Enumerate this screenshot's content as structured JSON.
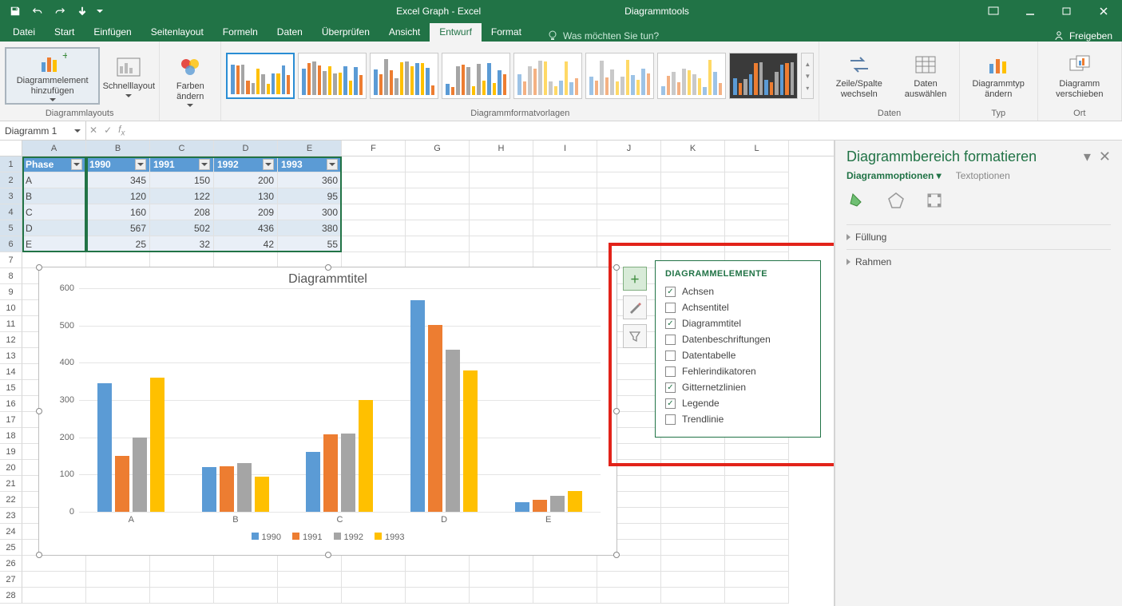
{
  "titlebar": {
    "app_title": "Excel Graph - Excel",
    "context_tab": "Diagrammtools"
  },
  "tabs": {
    "items": [
      "Datei",
      "Start",
      "Einfügen",
      "Seitenlayout",
      "Formeln",
      "Daten",
      "Überprüfen",
      "Ansicht",
      "Entwurf",
      "Format"
    ],
    "active": "Entwurf",
    "tellme": "Was möchten Sie tun?",
    "share": "Freigeben"
  },
  "ribbon": {
    "layouts_group": "Diagrammlayouts",
    "add_element": "Diagrammelement hinzufügen",
    "quick_layout": "Schnelllayout",
    "colors": "Farben ändern",
    "styles_group": "Diagrammformatvorlagen",
    "data_group": "Daten",
    "switch": "Zeile/Spalte wechseln",
    "select_data": "Daten auswählen",
    "type_group": "Typ",
    "change_type": "Diagrammtyp ändern",
    "loc_group": "Ort",
    "move_chart": "Diagramm verschieben"
  },
  "namebox": "Diagramm 1",
  "grid": {
    "cols": [
      "A",
      "B",
      "C",
      "D",
      "E",
      "F",
      "G",
      "H",
      "I",
      "J",
      "K",
      "L"
    ],
    "headers": [
      "Phase",
      "1990",
      "1991",
      "1992",
      "1993"
    ],
    "rows": [
      {
        "label": "A",
        "vals": [
          345,
          150,
          200,
          360
        ]
      },
      {
        "label": "B",
        "vals": [
          120,
          122,
          130,
          95
        ]
      },
      {
        "label": "C",
        "vals": [
          160,
          208,
          209,
          300
        ]
      },
      {
        "label": "D",
        "vals": [
          567,
          502,
          436,
          380
        ]
      },
      {
        "label": "E",
        "vals": [
          25,
          32,
          42,
          55
        ]
      }
    ]
  },
  "chart_data": {
    "type": "bar",
    "title": "Diagrammtitel",
    "categories": [
      "A",
      "B",
      "C",
      "D",
      "E"
    ],
    "series": [
      {
        "name": "1990",
        "values": [
          345,
          120,
          160,
          567,
          25
        ]
      },
      {
        "name": "1991",
        "values": [
          150,
          122,
          208,
          502,
          32
        ]
      },
      {
        "name": "1992",
        "values": [
          200,
          130,
          209,
          436,
          42
        ]
      },
      {
        "name": "1993",
        "values": [
          360,
          95,
          300,
          380,
          55
        ]
      }
    ],
    "ylim": [
      0,
      600
    ],
    "yticks": [
      0,
      100,
      200,
      300,
      400,
      500,
      600
    ]
  },
  "flyout": {
    "title": "DIAGRAMMELEMENTE",
    "items": [
      {
        "label": "Achsen",
        "checked": true
      },
      {
        "label": "Achsentitel",
        "checked": false
      },
      {
        "label": "Diagrammtitel",
        "checked": true
      },
      {
        "label": "Datenbeschriftungen",
        "checked": false
      },
      {
        "label": "Datentabelle",
        "checked": false
      },
      {
        "label": "Fehlerindikatoren",
        "checked": false
      },
      {
        "label": "Gitternetzlinien",
        "checked": true
      },
      {
        "label": "Legende",
        "checked": true
      },
      {
        "label": "Trendlinie",
        "checked": false
      }
    ]
  },
  "sidepane": {
    "title": "Diagrammbereich formatieren",
    "tab_on": "Diagrammoptionen",
    "tab_off": "Textoptionen",
    "sec1": "Füllung",
    "sec2": "Rahmen"
  }
}
